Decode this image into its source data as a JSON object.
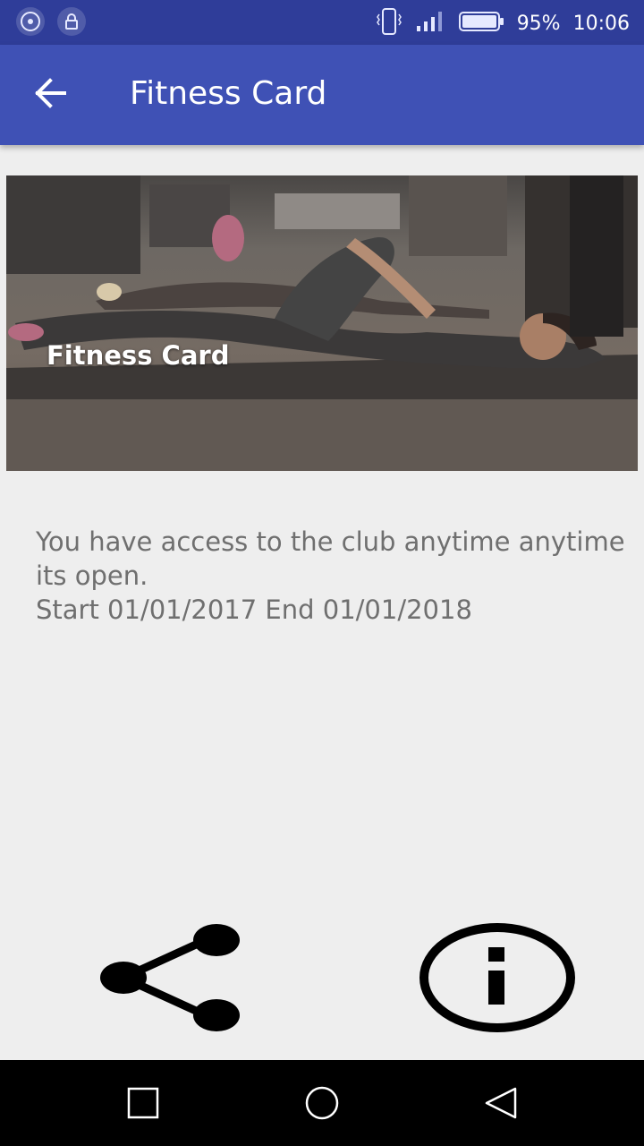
{
  "status_bar": {
    "battery_percent": "95%",
    "time": "10:06",
    "left_icons": [
      "cd-icon",
      "lock-icon"
    ],
    "right_icons": [
      "vibrate-icon",
      "signal-icon",
      "battery-icon"
    ]
  },
  "app_bar": {
    "title": "Fitness Card",
    "back_icon": "arrow-back-icon"
  },
  "hero": {
    "caption": "Fitness Card"
  },
  "description": {
    "text": "You have access to the club anytime anytime its open.\n Start 01/01/2017 End 01/01/2018"
  },
  "actions": {
    "share_icon": "share-icon",
    "info_icon": "info-icon"
  },
  "nav_bar": {
    "icons": [
      "recents-square-icon",
      "home-circle-icon",
      "back-triangle-icon"
    ]
  },
  "colors": {
    "status_bar": "#2f3d99",
    "app_bar": "#3f51b5",
    "background": "#eeeeee",
    "description_text": "#6f6f6f"
  }
}
